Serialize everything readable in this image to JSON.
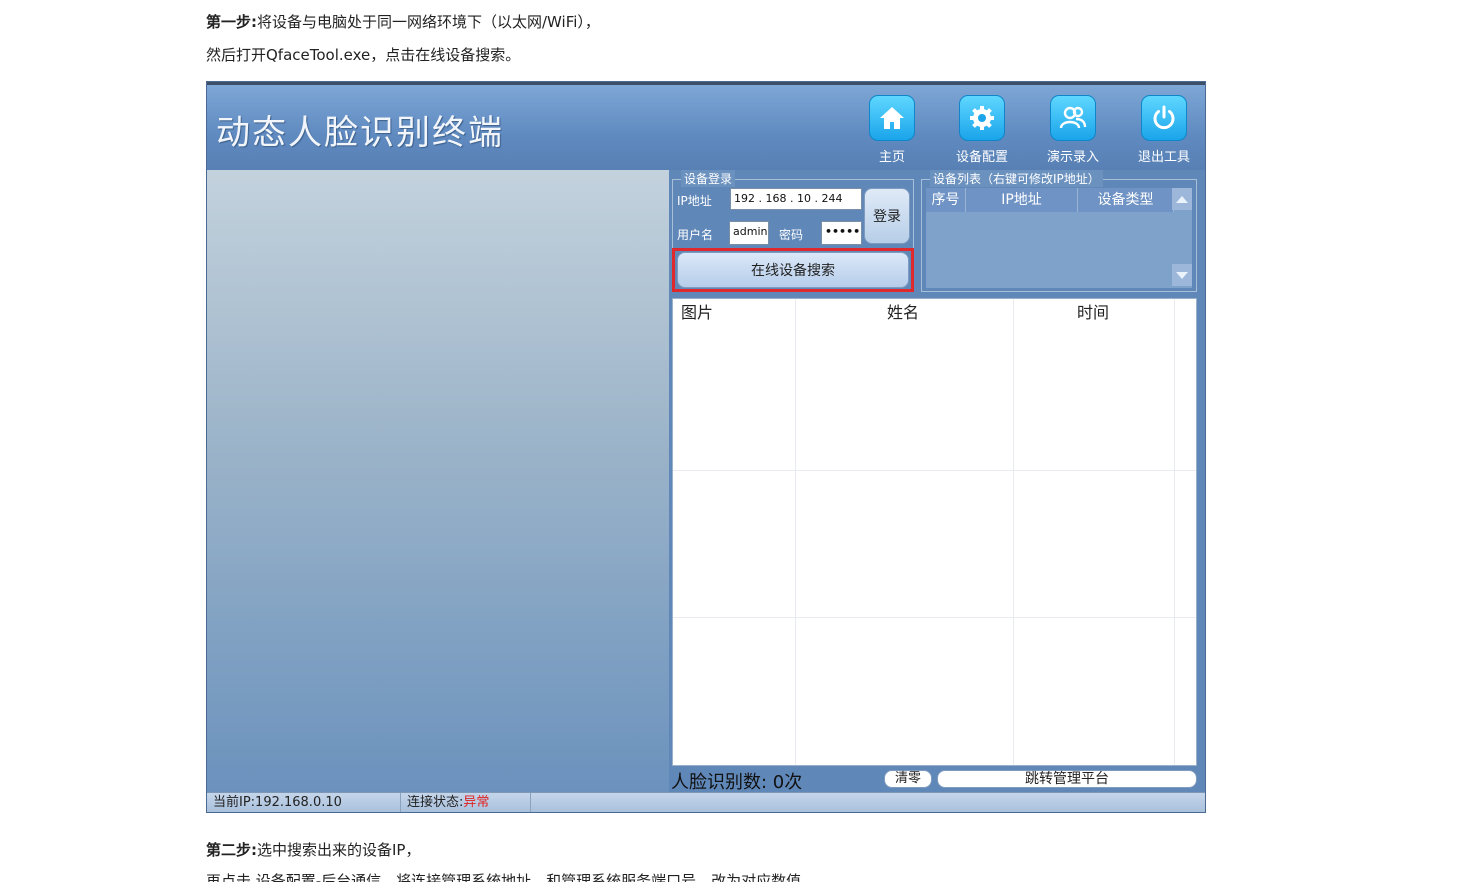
{
  "doc": {
    "step1_prefix": "第一步:",
    "step1_text": "将设备与电脑处于同一网络环境下（以太网/WiFi），",
    "step1_line2": "然后打开QfaceTool.exe，点击在线设备搜索。",
    "step2_prefix": "第二步:",
    "step2_text": "选中搜索出来的设备IP，",
    "step2_line2": "再点击 设备配置-后台通信，将连接管理系统地址，和管理系统服务端口号，改为对应数值"
  },
  "app": {
    "title": "动态人脸识别终端",
    "toolbar": [
      {
        "label": "主页",
        "icon": "home-icon"
      },
      {
        "label": "设备配置",
        "icon": "gear-icon"
      },
      {
        "label": "演示录入",
        "icon": "users-icon"
      },
      {
        "label": "退出工具",
        "icon": "power-icon"
      }
    ],
    "login": {
      "caption": "设备登录",
      "ip_label": "IP地址",
      "ip_value": "192 . 168 .  10  . 244",
      "user_label": "用户名",
      "user_value": "admin",
      "password_label": "密码",
      "password_value": "•••••",
      "login_button": "登录",
      "search_button": "在线设备搜索"
    },
    "device_list": {
      "caption": "设备列表（右键可修改IP地址）",
      "columns": [
        "序号",
        "IP地址",
        "设备类型"
      ]
    },
    "records": {
      "columns": [
        "图片",
        "姓名",
        "时间"
      ]
    },
    "count_label": "人脸识别数:  0次",
    "clear_button": "清零",
    "jump_button": "跳转管理平台",
    "status": {
      "current_ip": "当前IP:192.168.0.10",
      "connection_label": "连接状态:",
      "connection_value": "异常"
    }
  },
  "colors": {
    "accent_blue": "#5f87b8",
    "highlight_red": "#e0292c",
    "status_error": "#e02020"
  }
}
